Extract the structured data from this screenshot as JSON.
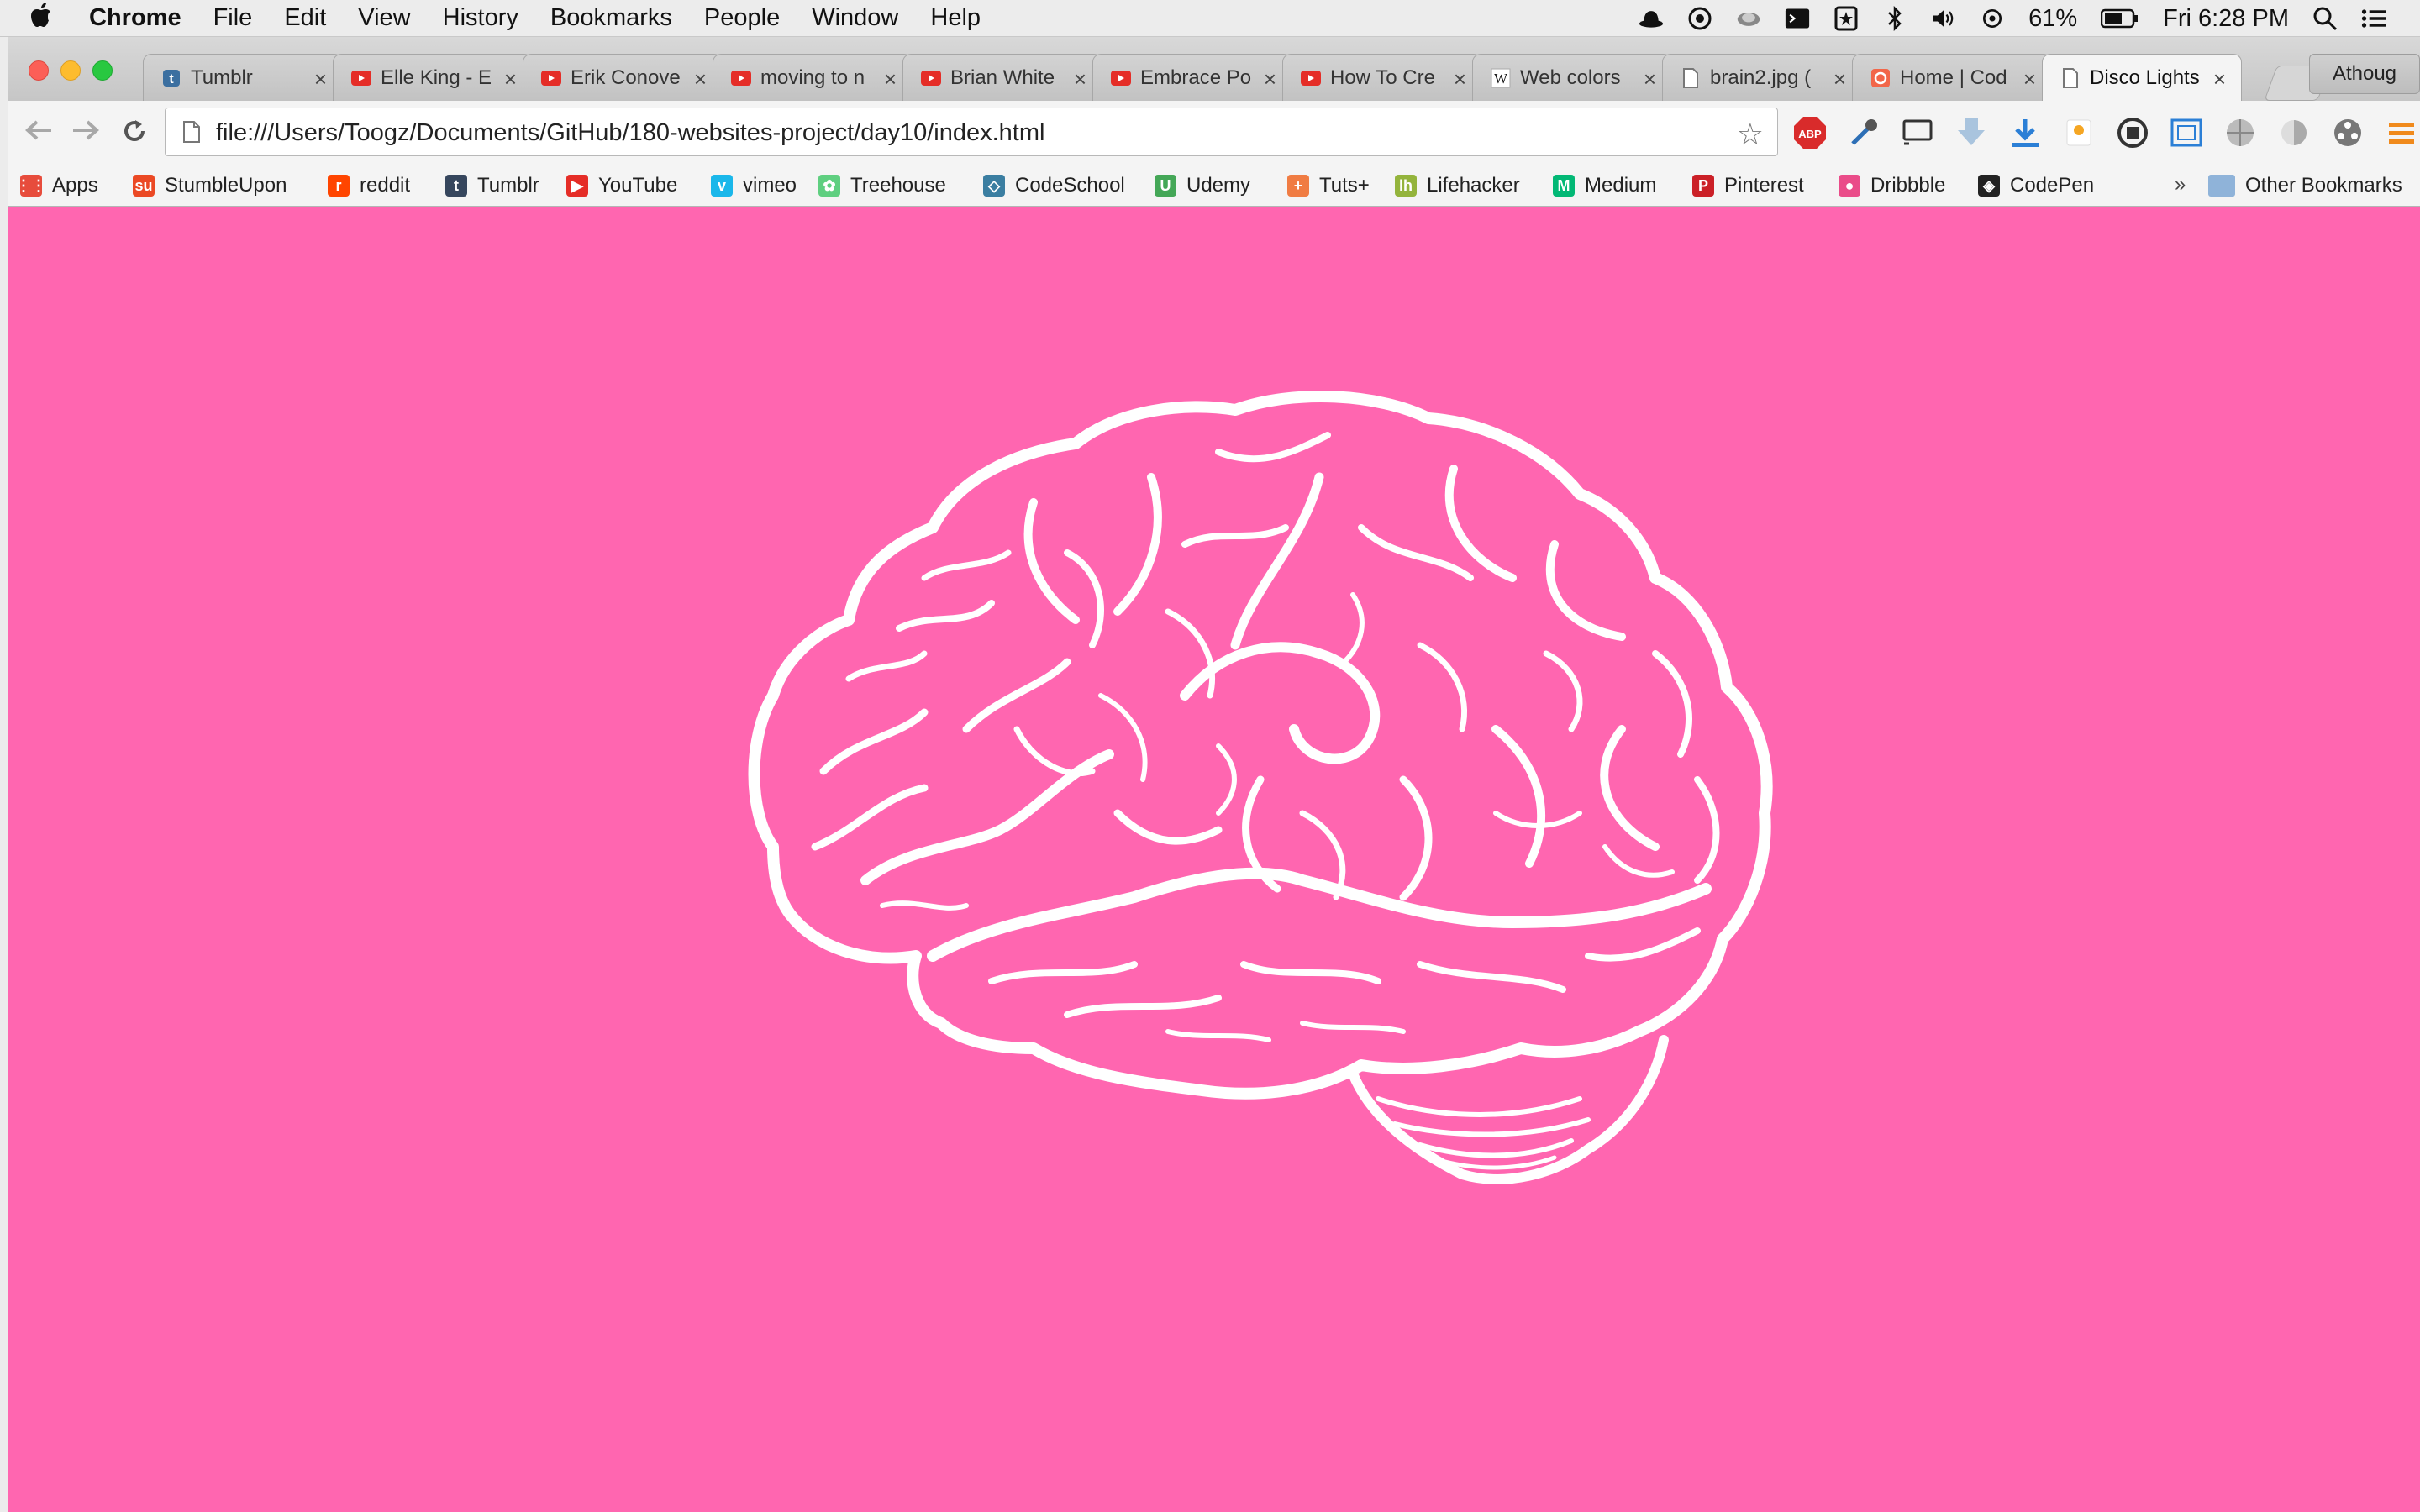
{
  "menubar": {
    "apple": "",
    "items": [
      "Chrome",
      "File",
      "Edit",
      "View",
      "History",
      "Bookmarks",
      "People",
      "Window",
      "Help"
    ],
    "battery": "61%",
    "clock": "Fri 6:28 PM"
  },
  "tabs": [
    {
      "title": "Tumblr",
      "favicon": "tumblr-icon",
      "active": false
    },
    {
      "title": "Elle King - E",
      "favicon": "youtube-icon",
      "active": false
    },
    {
      "title": "Erik Conove",
      "favicon": "youtube-icon",
      "active": false
    },
    {
      "title": "moving to n",
      "favicon": "youtube-icon",
      "active": false
    },
    {
      "title": "Brian White",
      "favicon": "youtube-icon",
      "active": false
    },
    {
      "title": "Embrace Po",
      "favicon": "youtube-icon",
      "active": false
    },
    {
      "title": "How To Cre",
      "favicon": "youtube-icon",
      "active": false
    },
    {
      "title": "Web colors",
      "favicon": "wikipedia-icon",
      "active": false
    },
    {
      "title": "brain2.jpg (",
      "favicon": "page-icon",
      "active": false
    },
    {
      "title": "Home | Cod",
      "favicon": "codecademy-icon",
      "active": false
    },
    {
      "title": "Disco Lights",
      "favicon": "page-icon",
      "active": true
    }
  ],
  "profile": "Athoug",
  "toolbar": {
    "url": "file:///Users/Toogz/Documents/GitHub/180-websites-project/day10/index.html",
    "abp_label": "ABP"
  },
  "bookmarks": [
    {
      "label": "Apps",
      "icon": "apps-grid-icon",
      "color": "#e74c3c"
    },
    {
      "label": "StumbleUpon",
      "icon": "stumbleupon-icon",
      "color": "#eb4924"
    },
    {
      "label": "reddit",
      "icon": "reddit-icon",
      "color": "#ff4500"
    },
    {
      "label": "Tumblr",
      "icon": "tumblr-icon",
      "color": "#36465d"
    },
    {
      "label": "YouTube",
      "icon": "youtube-icon",
      "color": "#e52d27"
    },
    {
      "label": "vimeo",
      "icon": "vimeo-icon",
      "color": "#1ab7ea"
    },
    {
      "label": "Treehouse",
      "icon": "treehouse-icon",
      "color": "#5fcf80"
    },
    {
      "label": "CodeSchool",
      "icon": "codeschool-icon",
      "color": "#3b7ea1"
    },
    {
      "label": "Udemy",
      "icon": "udemy-icon",
      "color": "#44a757"
    },
    {
      "label": "Tuts+",
      "icon": "tuts-icon",
      "color": "#f07c43"
    },
    {
      "label": "Lifehacker",
      "icon": "lifehacker-icon",
      "color": "#94b43c"
    },
    {
      "label": "Medium",
      "icon": "medium-icon",
      "color": "#02b875"
    },
    {
      "label": "Pinterest",
      "icon": "pinterest-icon",
      "color": "#cb2027"
    },
    {
      "label": "Dribbble",
      "icon": "dribbble-icon",
      "color": "#ea4c89"
    },
    {
      "label": "CodePen",
      "icon": "codepen-icon",
      "color": "#222222"
    }
  ],
  "bookmarks_overflow": "»",
  "other_bookmarks": "Other Bookmarks",
  "page": {
    "background": "#ff66b0",
    "illustration": "brain-illustration"
  }
}
